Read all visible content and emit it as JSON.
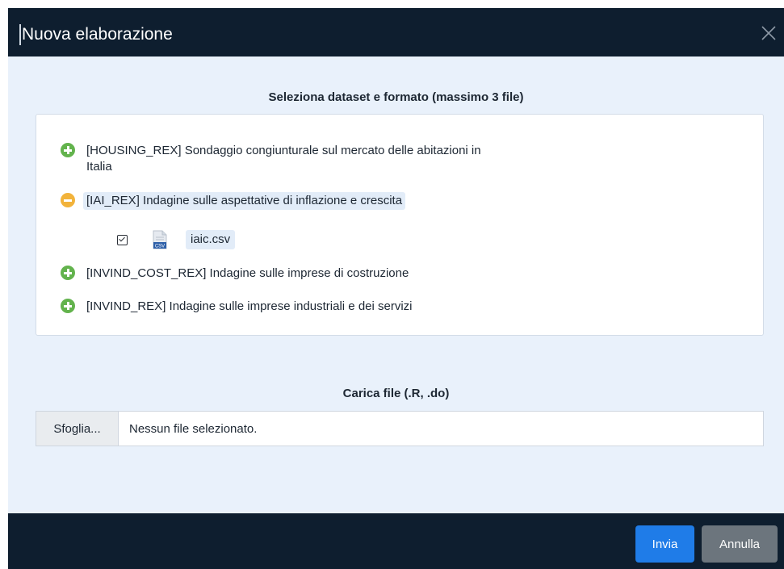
{
  "dialog": {
    "title": "Nuova elaborazione",
    "close_icon": "close-icon"
  },
  "datasets_section": {
    "heading": "Seleziona dataset e formato (massimo 3 file)",
    "items": [
      {
        "code_label": "[HOUSING_REX] Sondaggio congiunturale sul mercato delle abitazioni in",
        "label_cont": "Italia",
        "state": "collapsed",
        "icon": "plus-circle-icon"
      },
      {
        "code_label": "[IAI_REX] Indagine sulle aspettative di inflazione e crescita",
        "state": "expanded",
        "icon": "minus-circle-icon",
        "files": [
          {
            "name": "iaic.csv",
            "checked": true,
            "icon": "csv-file-icon"
          }
        ]
      },
      {
        "code_label": "[INVIND_COST_REX] Indagine sulle imprese di costruzione",
        "state": "collapsed",
        "icon": "plus-circle-icon"
      },
      {
        "code_label": "[INVIND_REX] Indagine sulle imprese industriali e dei servizi",
        "state": "collapsed",
        "icon": "plus-circle-icon"
      }
    ]
  },
  "upload_section": {
    "heading": "Carica file (.R, .do)",
    "browse_label": "Sfoglia...",
    "status": "Nessun file selezionato."
  },
  "footer": {
    "submit_label": "Invia",
    "cancel_label": "Annulla"
  },
  "colors": {
    "header_bg": "#0e1e2f",
    "body_bg": "#e9f1fb",
    "expand_green": "#63b34d",
    "collapse_orange": "#f2b33b",
    "primary_blue": "#1f7ce8",
    "secondary_gray": "#6c757d"
  }
}
